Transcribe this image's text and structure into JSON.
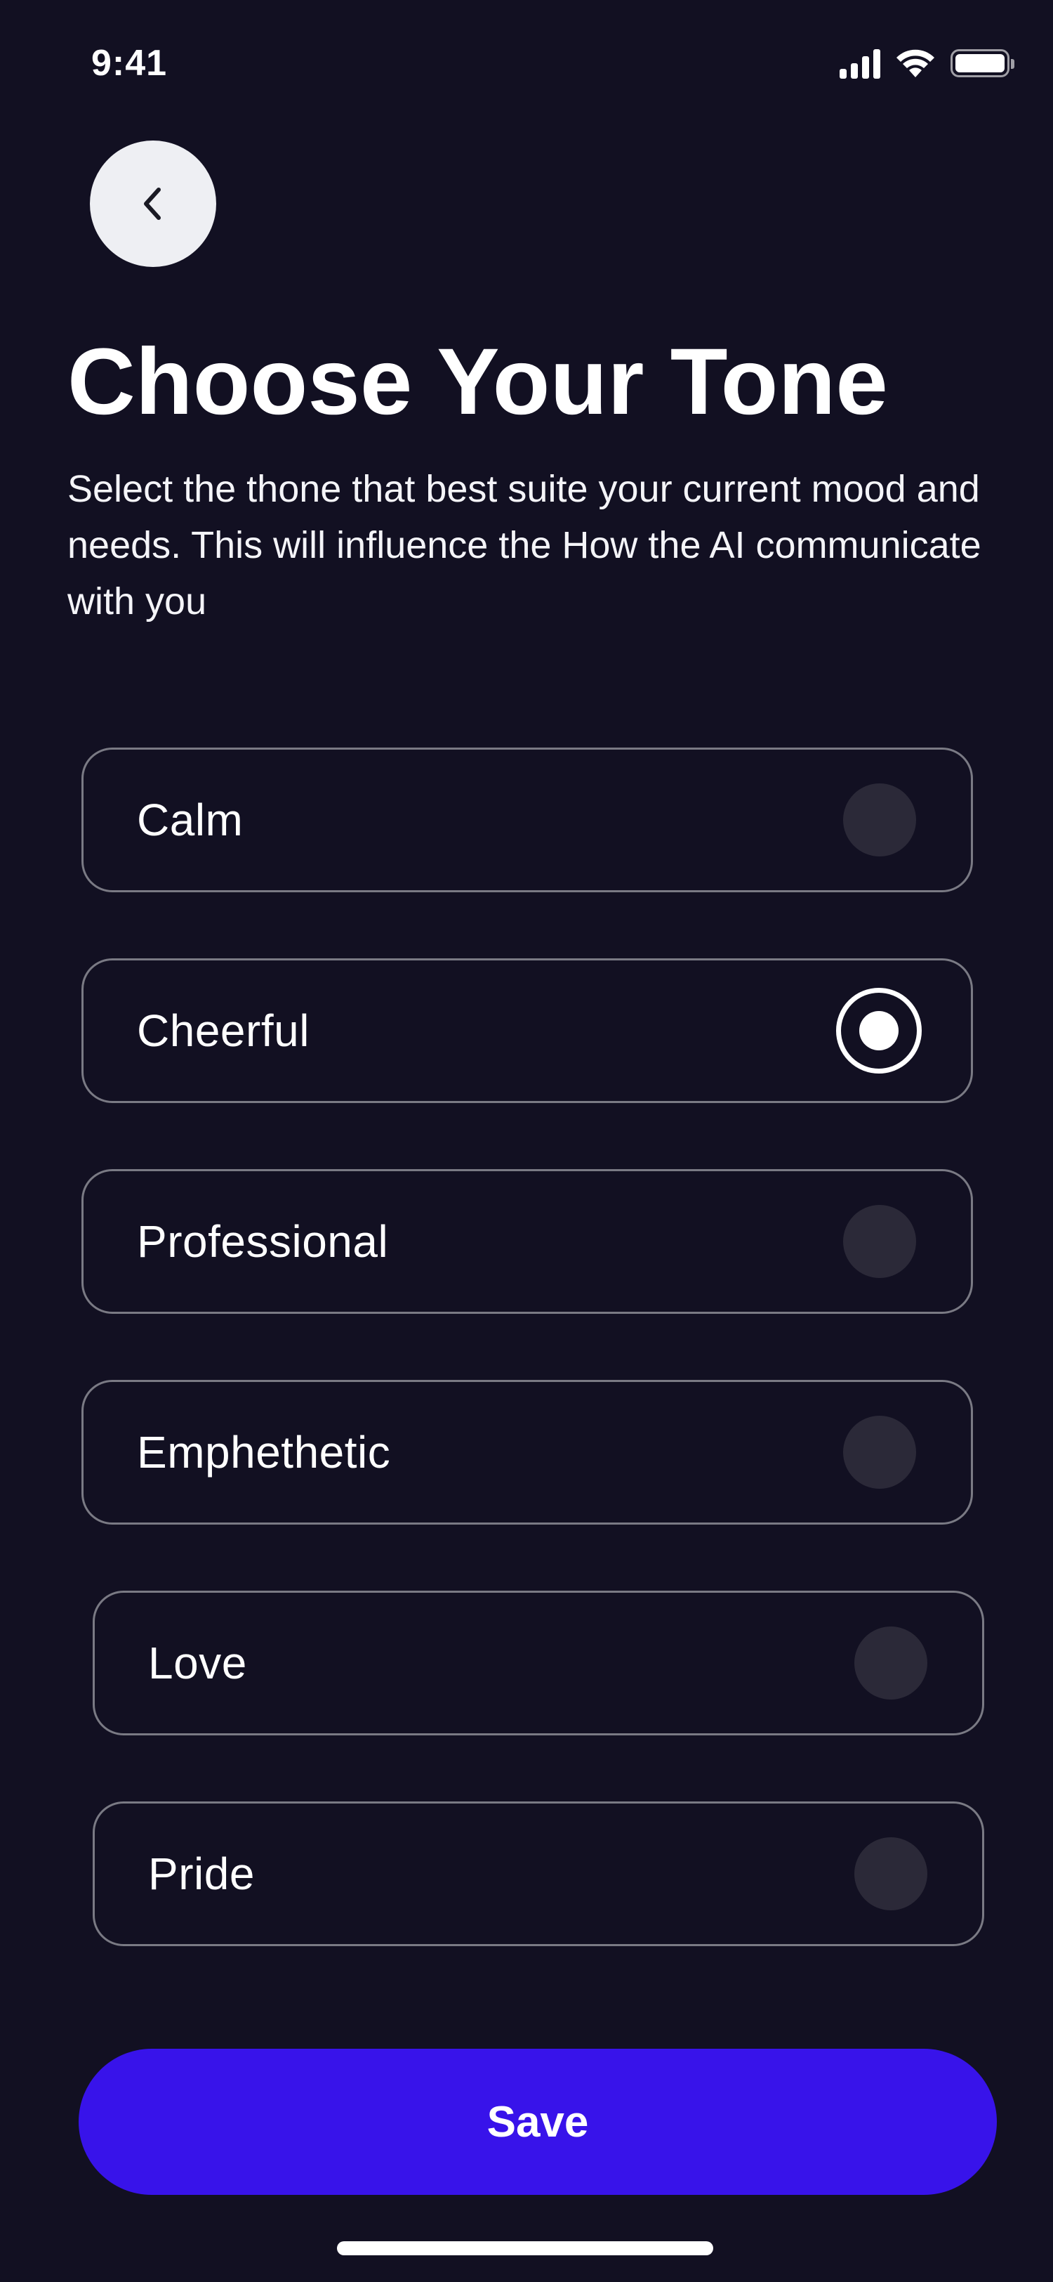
{
  "status_bar": {
    "time": "9:41",
    "signal_icon": "cellular-signal-icon",
    "wifi_icon": "wifi-icon",
    "battery_icon": "battery-icon"
  },
  "header": {
    "back_icon": "chevron-left-icon",
    "title": "Choose Your Tone",
    "description": "Select the thone that best suite your current mood and needs. This will influence the How the AI communicate with you"
  },
  "tones": [
    {
      "label": "Calm",
      "selected": false
    },
    {
      "label": "Cheerful",
      "selected": true
    },
    {
      "label": "Professional",
      "selected": false
    },
    {
      "label": "Emphethetic",
      "selected": false
    },
    {
      "label": "Love",
      "selected": false
    },
    {
      "label": "Pride",
      "selected": false
    }
  ],
  "save_label": "Save",
  "colors": {
    "background": "#121022",
    "accent": "#3813ea",
    "option_border": "#7a7a84",
    "radio_unselected": "#2b2938",
    "back_button_bg": "#eeeff3"
  }
}
